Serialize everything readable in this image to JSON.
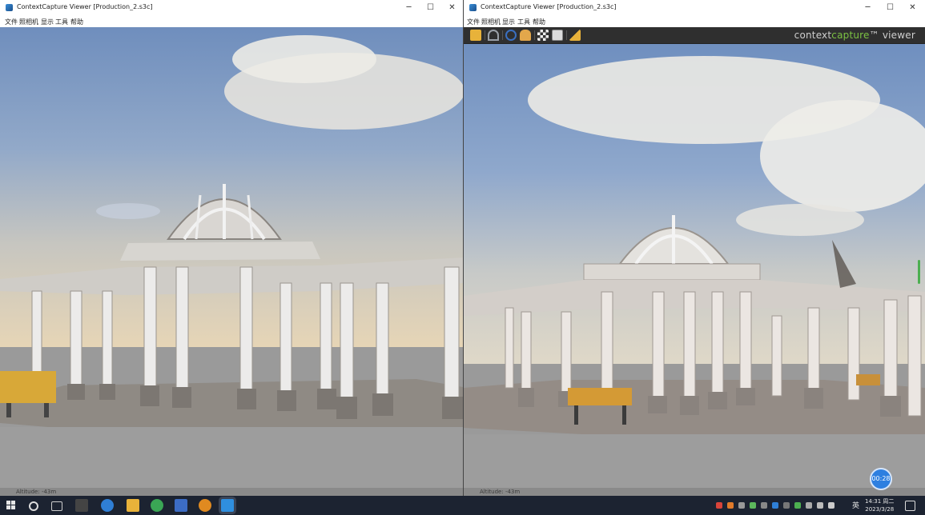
{
  "left_window": {
    "title": "ContextCapture Viewer [Production_2.s3c]",
    "menu": [
      "文件",
      "照相机",
      "显示",
      "工具",
      "帮助"
    ],
    "status_text": "Altitude: -43m"
  },
  "right_window": {
    "title": "ContextCapture Viewer [Production_2.s3c]",
    "menu": [
      "文件",
      "照相机",
      "显示",
      "工具",
      "帮助"
    ],
    "brand_prefix": "context",
    "brand_accent": "capture",
    "brand_suffix": "™ viewer",
    "status_text": "Altitude: -43m"
  },
  "window_controls": {
    "minimize": "─",
    "maximize": "☐",
    "close": "✕"
  },
  "toolbar_icons": [
    "folder-open-icon",
    "orbit-icon",
    "target-icon",
    "pan-hand-icon",
    "checker-icon",
    "texture-icon",
    "measure-icon"
  ],
  "timer": "00:28",
  "clock": {
    "time": "14:31 周二",
    "date": "2023/3/28"
  },
  "taskbar_icons": [
    "windows-start-icon",
    "search-icon",
    "task-view-icon",
    "app-icon",
    "edge-icon",
    "file-explorer-icon",
    "green-app-icon",
    "network-app-icon",
    "search-app-icon",
    "contextcapture-icon"
  ],
  "tray_lang": "英",
  "colors": {
    "accent_green": "#7cc243",
    "timer_blue": "#2d7fe0",
    "taskbar": "#1c2331"
  }
}
